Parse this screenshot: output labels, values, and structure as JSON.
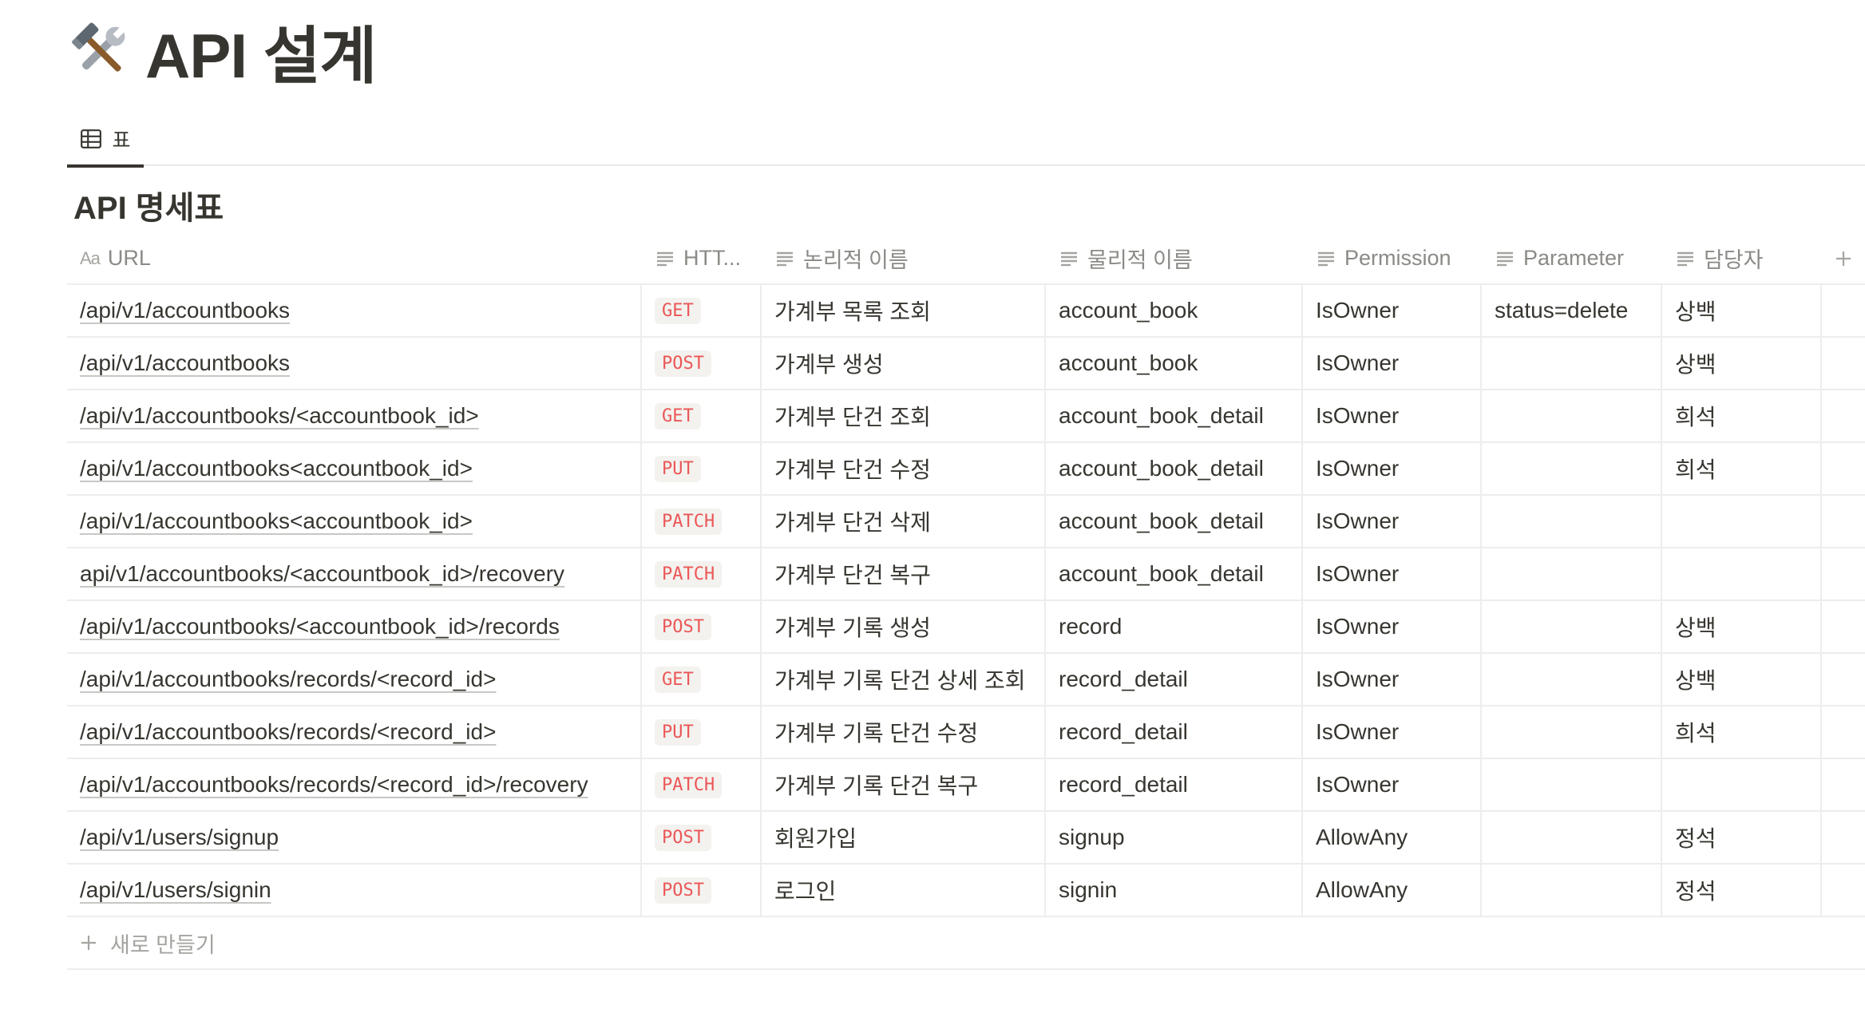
{
  "page": {
    "title": "API 설계",
    "title_icon": "hammer-and-wrench-icon"
  },
  "view": {
    "tab_label": "표",
    "tab_icon": "table-icon"
  },
  "database": {
    "title": "API 명세표",
    "columns": {
      "url": "URL",
      "http": "HTT...",
      "logical": "논리적 이름",
      "physical": "물리적 이름",
      "permission": "Permission",
      "parameter": "Parameter",
      "owner": "담당자"
    },
    "rows": [
      {
        "url": "/api/v1/accountbooks",
        "method": "GET",
        "logical": "가계부 목록 조회",
        "physical": "account_book",
        "permission": "IsOwner",
        "parameter": "status=delete",
        "owner": "상백"
      },
      {
        "url": "/api/v1/accountbooks",
        "method": "POST",
        "logical": "가계부 생성",
        "physical": "account_book",
        "permission": "IsOwner",
        "parameter": "",
        "owner": "상백"
      },
      {
        "url": "/api/v1/accountbooks/<accountbook_id>",
        "method": "GET",
        "logical": "가계부 단건 조회",
        "physical": "account_book_detail",
        "permission": "IsOwner",
        "parameter": "",
        "owner": "희석"
      },
      {
        "url": "/api/v1/accountbooks<accountbook_id>",
        "method": "PUT",
        "logical": "가계부 단건 수정",
        "physical": "account_book_detail",
        "permission": "IsOwner",
        "parameter": "",
        "owner": "희석"
      },
      {
        "url": "/api/v1/accountbooks<accountbook_id>",
        "method": "PATCH",
        "logical": "가계부 단건 삭제",
        "physical": "account_book_detail",
        "permission": "IsOwner",
        "parameter": "",
        "owner": ""
      },
      {
        "url": "api/v1/accountbooks/<accountbook_id>/recovery",
        "method": "PATCH",
        "logical": "가계부 단건 복구",
        "physical": "account_book_detail",
        "permission": "IsOwner",
        "parameter": "",
        "owner": ""
      },
      {
        "url": "/api/v1/accountbooks/<accountbook_id>/records",
        "method": "POST",
        "logical": "가계부 기록 생성",
        "physical": "record",
        "permission": "IsOwner",
        "parameter": "",
        "owner": "상백"
      },
      {
        "url": "/api/v1/accountbooks/records/<record_id>",
        "method": "GET",
        "logical": "가계부 기록 단건 상세 조회",
        "physical": "record_detail",
        "permission": "IsOwner",
        "parameter": "",
        "owner": "상백"
      },
      {
        "url": "/api/v1/accountbooks/records/<record_id>",
        "method": "PUT",
        "logical": "가계부 기록 단건 수정",
        "physical": "record_detail",
        "permission": "IsOwner",
        "parameter": "",
        "owner": "희석"
      },
      {
        "url": "/api/v1/accountbooks/records/<record_id>/recovery",
        "method": "PATCH",
        "logical": "가계부 기록 단건 복구",
        "physical": "record_detail",
        "permission": "IsOwner",
        "parameter": "",
        "owner": ""
      },
      {
        "url": "/api/v1/users/signup",
        "method": "POST",
        "logical": "회원가입",
        "physical": "signup",
        "permission": "AllowAny",
        "parameter": "",
        "owner": "정석"
      },
      {
        "url": "/api/v1/users/signin",
        "method": "POST",
        "logical": "로그인",
        "physical": "signin",
        "permission": "AllowAny",
        "parameter": "",
        "owner": "정석"
      }
    ],
    "new_row_label": "새로 만들기"
  },
  "colors": {
    "text": "#37352f",
    "muted": "#8b8a86",
    "border": "#ededeb",
    "code_text": "#eb5757",
    "code_bg": "#f3f2ef"
  }
}
